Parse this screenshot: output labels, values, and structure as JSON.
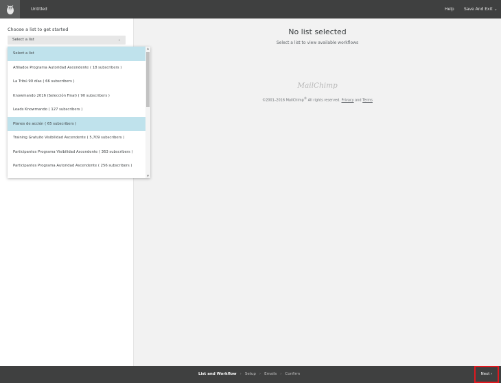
{
  "header": {
    "title": "Untitled",
    "help_label": "Help",
    "save_exit_label": "Save And Exit",
    "save_exit_chevron": "⌄"
  },
  "left": {
    "choose_label": "Choose a list to get started",
    "select_value": "Select a list",
    "select_arrow": "⌄",
    "dropdown": {
      "items": [
        "Select a list",
        "Afiliados Programa Autoridad Ascendente ( 18 subscribers )",
        "La Tribú 90 días ( 66 subscribers )",
        "Knowmando 2016 (Selección Final) ( 90 subscribers )",
        "Leads Knowmando ( 127 subscribers )",
        "Planes de acción ( 65 subscribers )",
        "Training Gratuito Visibilidad Ascendente ( 5,709 subscribers )",
        "Participantes Programa Visibilidad Ascendente ( 363 subscribers )",
        "Participantes Programa Autoridad Ascendente ( 256 subscribers )"
      ],
      "highlighted": [
        "Select a list",
        "Planes de acción ( 65 subscribers )"
      ]
    }
  },
  "main": {
    "heading": "No list selected",
    "subheading": "Select a list to view available workflows",
    "logo_text": "MailChimp",
    "copyright_prefix": "©2001–2016 MailChimp",
    "copyright_reg": "®",
    "copyright_mid": " All rights reserved. ",
    "privacy_label": "Privacy",
    "and_label": " and ",
    "terms_label": "Terms"
  },
  "footer": {
    "steps": [
      "List and Workflow",
      "Setup",
      "Emails",
      "Confirm"
    ],
    "active_step": "List and Workflow",
    "separator": "›",
    "next_label": "Next ›"
  },
  "colors": {
    "bar_dark": "#3f4040",
    "highlight": "#bfe2ec",
    "next_outline": "#e0191f"
  }
}
